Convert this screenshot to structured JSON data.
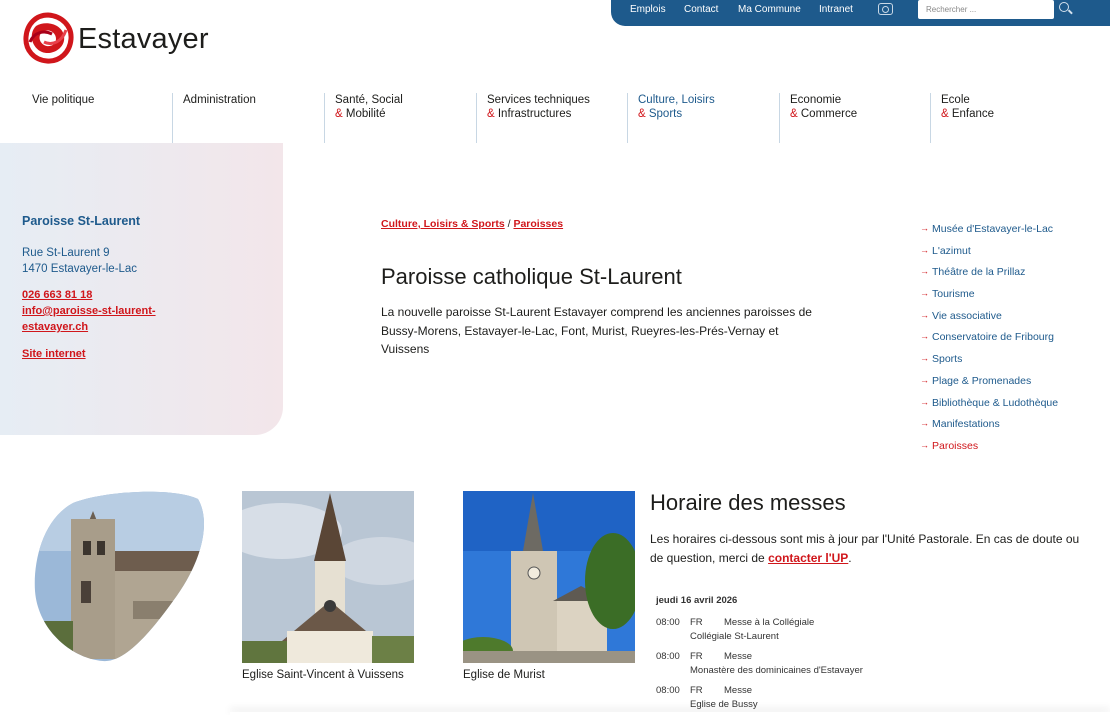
{
  "topbar": {
    "links": [
      "Emplois",
      "Contact",
      "Ma Commune",
      "Intranet"
    ],
    "search_placeholder": "Rechercher ...",
    "colors": {
      "bar": "#1e5a8c"
    }
  },
  "logo": {
    "text": "Estavayer",
    "icon": "estavayer-logo-icon"
  },
  "nav": [
    {
      "line1": "Vie politique",
      "amp": "",
      "line2": ""
    },
    {
      "line1": "Administration",
      "amp": "",
      "line2": ""
    },
    {
      "line1": "Santé, Social",
      "amp": "&",
      "line2": " Mobilité"
    },
    {
      "line1": "Services techniques",
      "amp": "&",
      "line2": " Infrastructures"
    },
    {
      "line1": "Culture, Loisirs",
      "amp": "&",
      "line2": " Sports"
    },
    {
      "line1": "Economie",
      "amp": "&",
      "line2": " Commerce"
    },
    {
      "line1": "Ecole",
      "amp": "&",
      "line2": " Enfance"
    }
  ],
  "contact": {
    "name": "Paroisse St-Laurent",
    "street": "Rue St-Laurent 9",
    "city": "1470 Estavayer-le-Lac",
    "phone": "026 663 81 18",
    "email_line1": "info@paroisse-st-laurent-",
    "email_line2": "estavayer.ch",
    "website": "Site internet"
  },
  "breadcrumb": {
    "part1": "Culture, Loisirs & Sports",
    "sep": " / ",
    "part2": "Paroisses"
  },
  "page": {
    "title": "Paroisse catholique St-Laurent",
    "intro": "La nouvelle paroisse St-Laurent Estavayer comprend les anciennes paroisses de Bussy-Morens, Estavayer-le-Lac, Font, Murist, Rueyres-les-Prés-Vernay et Vuissens"
  },
  "submenu": [
    "Musée d'Estavayer-le-Lac",
    "L'azimut",
    "Théâtre de la Prillaz",
    "Tourisme",
    "Vie associative",
    "Conservatoire de Fribourg",
    "Sports",
    "Plage & Promenades",
    "Bibliothèque & Ludothèque",
    "Manifestations",
    "Paroisses"
  ],
  "gallery": [
    {
      "caption": ""
    },
    {
      "caption": "Eglise Saint-Vincent à Vuissens"
    },
    {
      "caption": "Eglise de Murist"
    }
  ],
  "schedule": {
    "heading": "Horaire des messes",
    "intro_text": "Les horaires ci-dessous sont mis à jour par l'Unité Pastorale. En cas de doute ou de question, merci de ",
    "intro_link": "contacter l'UP",
    "intro_end": ".",
    "date": "jeudi 16 avril 2026",
    "entries": [
      {
        "time": "08:00",
        "lang": "FR",
        "kind": "Messe à la Collégiale",
        "place": "Collégiale St-Laurent"
      },
      {
        "time": "08:00",
        "lang": "FR",
        "kind": "Messe",
        "place": "Monastère des dominicaines d'Estavayer"
      },
      {
        "time": "08:00",
        "lang": "FR",
        "kind": "Messe",
        "place": "Eglise de Bussy"
      }
    ]
  }
}
